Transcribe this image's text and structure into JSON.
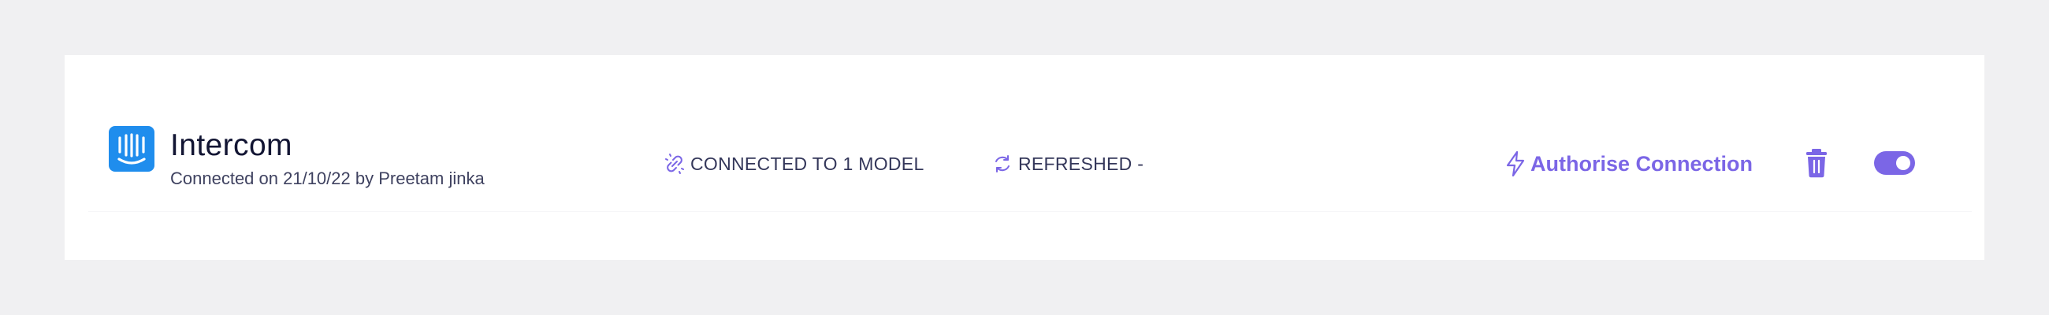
{
  "integration": {
    "name": "Intercom",
    "subtitle": "Connected on 21/10/22 by Preetam jinka",
    "logo_icon": "intercom-logo-icon",
    "logo_color": "#1f8ded"
  },
  "status": {
    "models_text": "CONNECTED TO 1 MODEL",
    "models_icon": "link-icon",
    "refreshed_text": "REFRESHED -",
    "refreshed_icon": "refresh-icon"
  },
  "actions": {
    "authorise_label": "Authorise Connection",
    "authorise_icon": "lightning-bolt-icon",
    "delete_icon": "trash-icon",
    "toggle_enabled": true,
    "accent_color": "#7b66e6"
  }
}
